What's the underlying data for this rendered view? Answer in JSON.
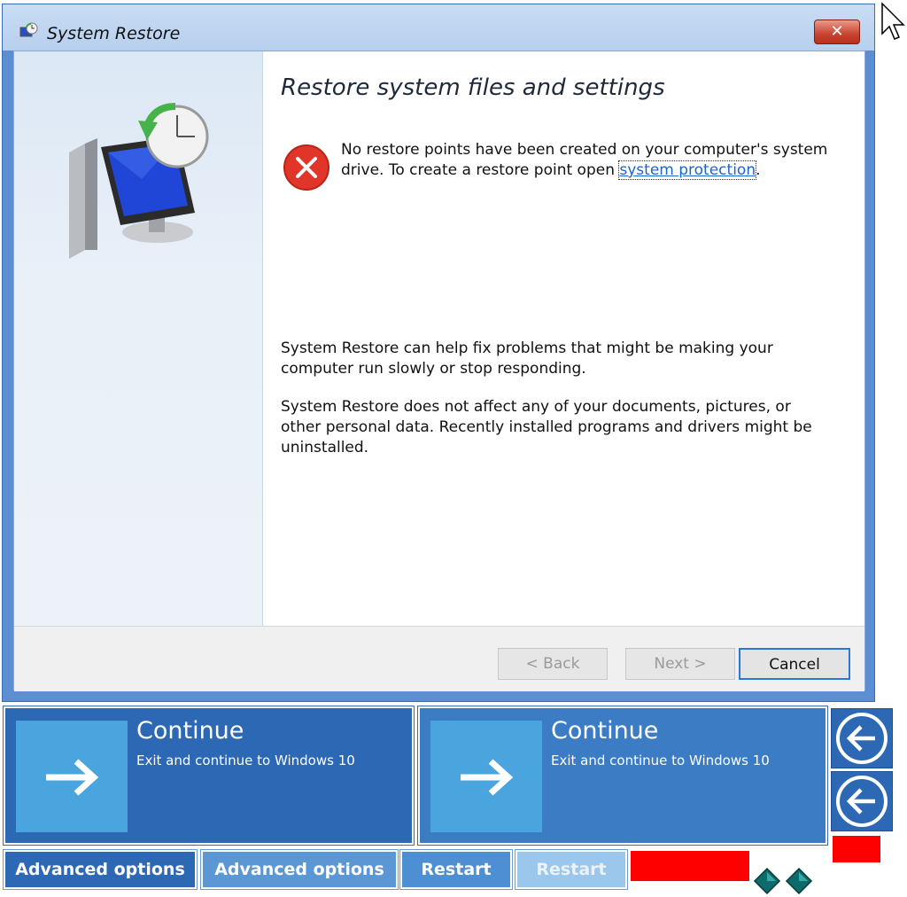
{
  "window": {
    "title": "System Restore",
    "close_label": "✕"
  },
  "content": {
    "heading": "Restore system files and settings",
    "error_text": "No restore points have been created on your computer's system drive. To create a restore point open ",
    "error_link": "system protection",
    "error_suffix": ".",
    "para1": "System Restore can help fix problems that might be making your computer run slowly or stop responding.",
    "para2": "System Restore does not affect any of your documents, pictures, or other personal data. Recently installed programs and drivers might be uninstalled."
  },
  "footer": {
    "back_label": "< Back",
    "next_label": "Next >",
    "cancel_label": "Cancel"
  },
  "tiles": [
    {
      "title": "Continue",
      "subtitle": "Exit and continue to Windows 10"
    },
    {
      "title": "Continue",
      "subtitle": "Exit and continue to Windows 10"
    }
  ],
  "bottom_buttons": [
    {
      "label": "Advanced options"
    },
    {
      "label": "Advanced options"
    },
    {
      "label": "Restart"
    },
    {
      "label": "Restart"
    }
  ],
  "icons": {
    "title": "system-restore-icon",
    "hero": "system-restore-monitor-icon",
    "error": "error-x-icon",
    "tile_arrow": "arrow-right-icon",
    "back": "back-arrow-circle-icon",
    "cursor": "mouse-cursor-icon",
    "diamonds": "diamond-icon"
  },
  "colors": {
    "tile_primary": "#2d68b4",
    "tile_secondary": "#3b7cc4",
    "error_red": "#e2352a",
    "link_blue": "#1a66cc",
    "red_block": "#ff0000"
  }
}
